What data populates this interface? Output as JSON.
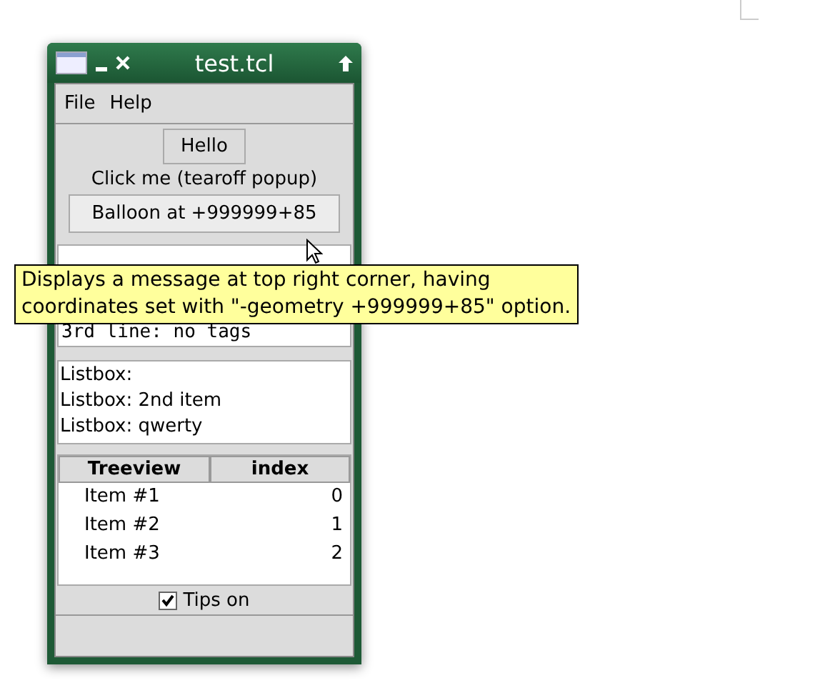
{
  "window": {
    "title": "test.tcl"
  },
  "menu": [
    {
      "label": "File"
    },
    {
      "label": "Help"
    }
  ],
  "hello_button": "Hello",
  "popup_label": "Click me (tearoff popup)",
  "balloon_button": "Balloon at +999999+85",
  "text_widget": {
    "lines": [
      "3rd line: no tags"
    ]
  },
  "listbox": [
    "Listbox:",
    "Listbox: 2nd item",
    "Listbox: qwerty"
  ],
  "treeview": {
    "columns": [
      "Treeview",
      "index"
    ],
    "rows": [
      {
        "name": "Item #1",
        "index": "0"
      },
      {
        "name": "Item #2",
        "index": "1"
      },
      {
        "name": "Item #3",
        "index": "2"
      }
    ]
  },
  "tips": {
    "label": "Tips on",
    "checked": true
  },
  "tooltip": {
    "lines": [
      "Displays a message at top right corner, having",
      "coordinates set with \"-geometry +999999+85\" option."
    ]
  }
}
